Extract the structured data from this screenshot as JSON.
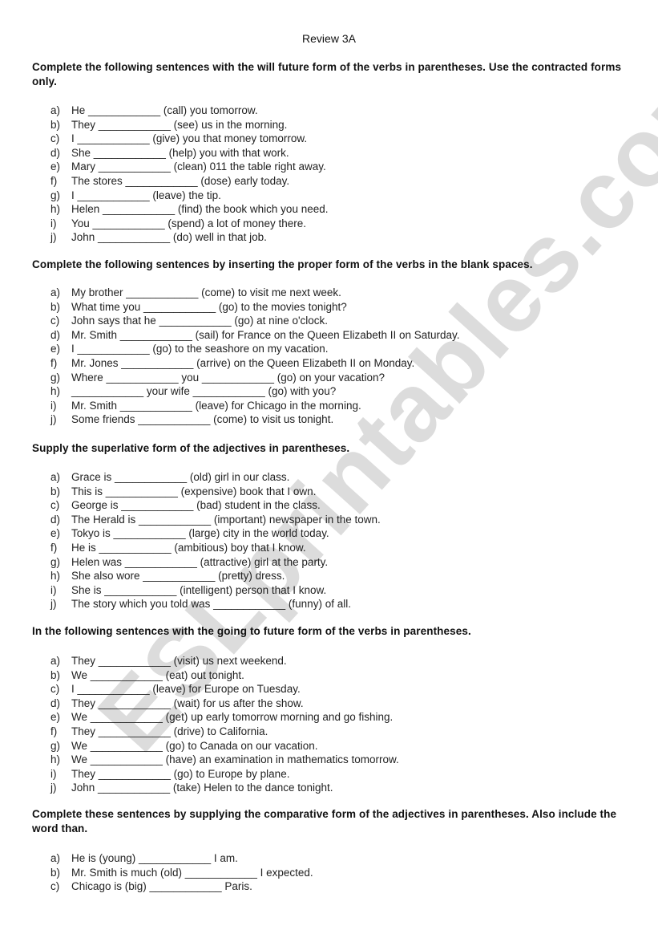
{
  "watermark": "ESLprintables.com",
  "title": "Review 3A",
  "sections": [
    {
      "instruction": "Complete the following sentences with the will future form of the verbs in parentheses. Use the contracted forms only.",
      "items": [
        {
          "letter": "a)",
          "text": "He ____________ (call) you tomorrow."
        },
        {
          "letter": "b)",
          "text": "They ____________ (see) us in the morning."
        },
        {
          "letter": "c)",
          "text": "I ____________ (give) you that money tomorrow."
        },
        {
          "letter": "d)",
          "text": "She ____________ (help) you with that work."
        },
        {
          "letter": "e)",
          "text": "Mary ____________ (clean) 011 the table right away."
        },
        {
          "letter": "f)",
          "text": "The stores ____________ (dose) early today."
        },
        {
          "letter": "g)",
          "text": "I ____________ (leave) the tip."
        },
        {
          "letter": "h)",
          "text": "Helen ____________ (find) the book which you need."
        },
        {
          "letter": "i)",
          "text": "You ____________ (spend) a lot of money there."
        },
        {
          "letter": "j)",
          "text": "John ____________ (do) well in that job."
        }
      ]
    },
    {
      "instruction": "Complete the following sentences by inserting the proper form of the verbs in the blank spaces.",
      "items": [
        {
          "letter": "a)",
          "text": "My brother ____________ (come) to visit me next week."
        },
        {
          "letter": "b)",
          "text": "What time you ____________ (go) to the movies tonight?"
        },
        {
          "letter": "c)",
          "text": "John says that he ____________ (go) at nine o'clock."
        },
        {
          "letter": "d)",
          "text": "Mr. Smith ____________ (sail) for France on the Queen Elizabeth II on Saturday."
        },
        {
          "letter": "e)",
          "text": "I ____________ (go) to the seashore on my vacation."
        },
        {
          "letter": "f)",
          "text": "Mr. Jones ____________ (arrive) on the Queen Elizabeth II on Monday."
        },
        {
          "letter": "g)",
          "text": "Where ____________ you ____________ (go) on your vacation?"
        },
        {
          "letter": "h)",
          "text": "____________ your wife ____________ (go) with you?"
        },
        {
          "letter": "i)",
          "text": "Mr. Smith ____________ (leave) for Chicago in the morning."
        },
        {
          "letter": "j)",
          "text": "Some friends ____________ (come) to visit us tonight."
        }
      ]
    },
    {
      "instruction": "Supply the superlative form of the adjectives in parentheses.",
      "items": [
        {
          "letter": "a)",
          "text": "Grace is ____________ (old) girl in our class."
        },
        {
          "letter": "b)",
          "text": "This is ____________ (expensive) book that I own."
        },
        {
          "letter": "c)",
          "text": "George is ____________ (bad) student in the class."
        },
        {
          "letter": "d)",
          "text": "The Herald is ____________ (important) newspaper in the town."
        },
        {
          "letter": "e)",
          "text": "Tokyo is ____________ (large) city in the world today."
        },
        {
          "letter": "f)",
          "text": "He is ____________ (ambitious) boy that I know."
        },
        {
          "letter": "g)",
          "text": "Helen was ____________ (attractive) girl at the party."
        },
        {
          "letter": "h)",
          "text": "She also wore ____________ (pretty) dress."
        },
        {
          "letter": "i)",
          "text": "She is ____________ (intelligent) person that I know."
        },
        {
          "letter": "j)",
          "text": "The story which you told was ____________ (funny) of all."
        }
      ]
    },
    {
      "instruction": "In the following sentences with the going to future form of the verbs in parentheses.",
      "items": [
        {
          "letter": "a)",
          "text": "They ____________ (visit) us next weekend."
        },
        {
          "letter": "b)",
          "text": "We ____________ (eat) out tonight."
        },
        {
          "letter": "c)",
          "text": "I ____________ (leave) for Europe on Tuesday."
        },
        {
          "letter": "d)",
          "text": "They ____________ (wait) for us after the show."
        },
        {
          "letter": "e)",
          "text": "We ____________ (get) up early tomorrow morning and go fishing."
        },
        {
          "letter": "f)",
          "text": "They ____________ (drive) to California."
        },
        {
          "letter": "g)",
          "text": "We ____________ (go) to Canada on our vacation."
        },
        {
          "letter": "h)",
          "text": "We ____________ (have) an examination in mathematics tomorrow."
        },
        {
          "letter": "i)",
          "text": "They ____________ (go) to Europe by plane."
        },
        {
          "letter": "j)",
          "text": "John ____________ (take) Helen to the dance tonight."
        }
      ]
    },
    {
      "instruction": "Complete these sentences by supplying the comparative form of the adjectives in parentheses. Also include the word than.",
      "items": [
        {
          "letter": "a)",
          "text": "He is (young) ____________ I am."
        },
        {
          "letter": "b)",
          "text": "Mr. Smith is much (old) ____________ I expected."
        },
        {
          "letter": "c)",
          "text": "Chicago is (big) ____________ Paris."
        }
      ]
    }
  ]
}
